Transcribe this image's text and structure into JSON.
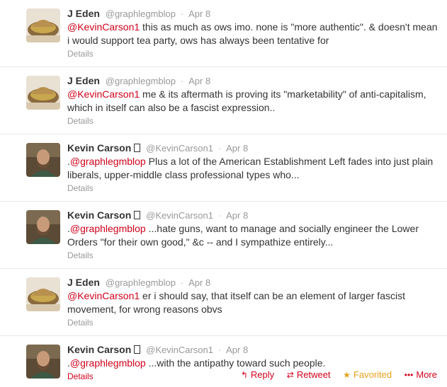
{
  "tweets": [
    {
      "author": "J Eden",
      "handle": "@graphlegmblop",
      "sep": "·",
      "time": "Apr 8",
      "mention": "@KevinCarson1",
      "body": " this as much as ows imo. none is \"more authentic\". & doesn't mean i would support tea party, ows has always been tentative for",
      "details": "Details",
      "avatar": "eden"
    },
    {
      "author": "J Eden",
      "handle": "@graphlegmblop",
      "sep": "·",
      "time": "Apr 8",
      "mention": "@KevinCarson1",
      "body": " me & its aftermath is proving its \"marketability\" of anti-capitalism, which in itself can also be a fascist expression..",
      "details": "Details",
      "avatar": "eden"
    },
    {
      "author": "Kevin Carson",
      "handle": "@KevinCarson1",
      "sep": "·",
      "time": "Apr 8",
      "prefix": ".",
      "mention": "@graphlegmblop",
      "body": " Plus a lot of the American Establishment Left fades into just plain liberals, upper-middle class professional types who...",
      "details": "Details",
      "avatar": "carson"
    },
    {
      "author": "Kevin Carson",
      "handle": "@KevinCarson1",
      "sep": "·",
      "time": "Apr 8",
      "prefix": ".",
      "mention": "@graphlegmblop",
      "body": " ...hate guns, want to manage and socially engineer the Lower Orders \"for their own good,\" &c -- and I sympathize entirely...",
      "details": "Details",
      "avatar": "carson"
    },
    {
      "author": "J Eden",
      "handle": "@graphlegmblop",
      "sep": "·",
      "time": "Apr 8",
      "mention": "@KevinCarson1",
      "body": " er i should say, that itself can be an element of larger fascist movement, for wrong reasons obvs",
      "details": "Details",
      "avatar": "eden"
    },
    {
      "author": "Kevin Carson",
      "handle": "@KevinCarson1",
      "sep": "·",
      "time": "Apr 8",
      "prefix": ".",
      "mention": "@graphlegmblop",
      "body": " ...with the antipathy toward such people.",
      "details": "Details",
      "avatar": "carson"
    }
  ],
  "actions": {
    "reply": "Reply",
    "retweet": "Retweet",
    "favorited": "Favorited",
    "more": "More"
  },
  "colors": {
    "link": "#d0021b",
    "favorited": "#e6a11b",
    "muted": "#999999"
  },
  "icons": {
    "reply": "reply-arrow-icon",
    "retweet": "retweet-icon",
    "favorited": "star-icon",
    "more": "ellipsis-icon"
  }
}
